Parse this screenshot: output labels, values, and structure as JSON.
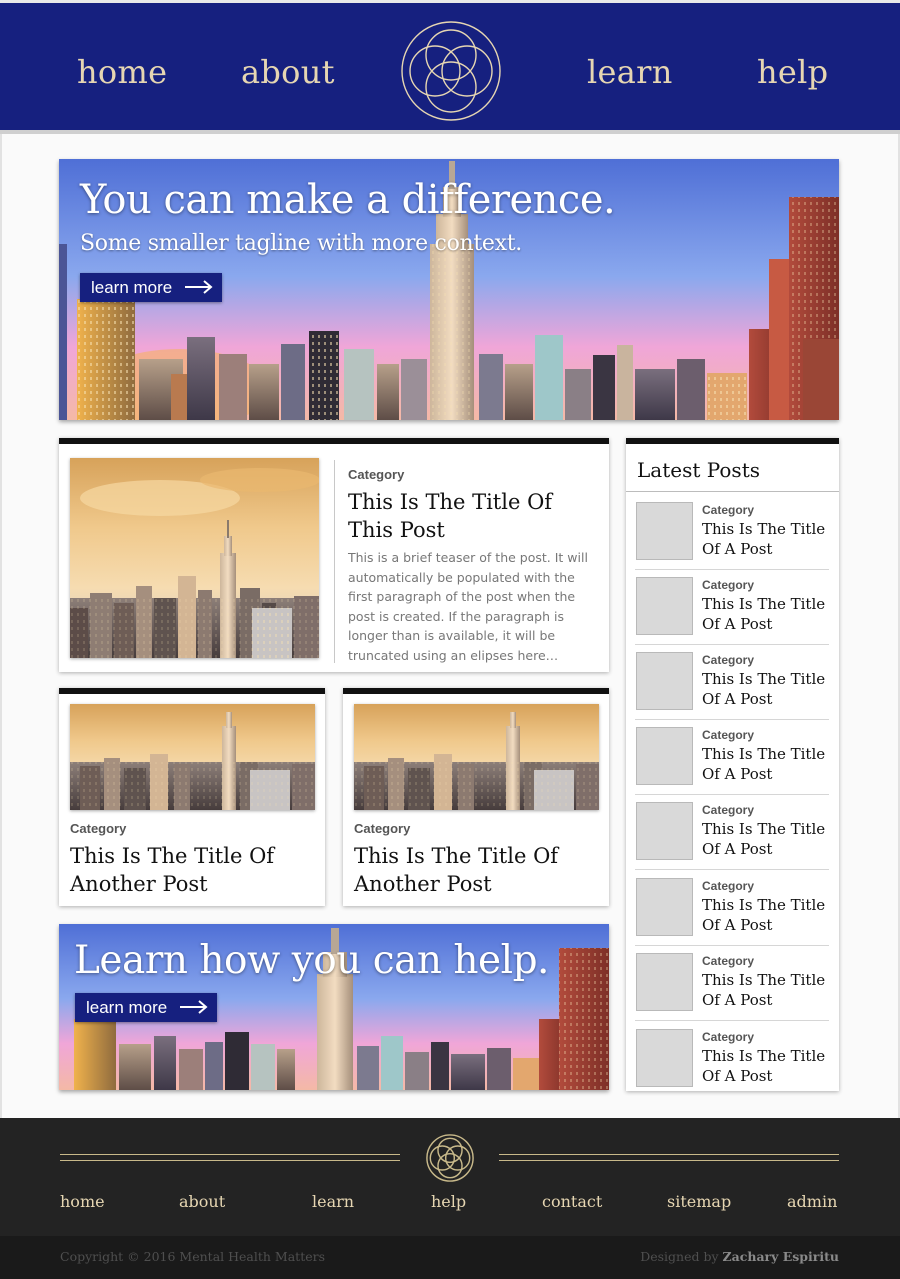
{
  "header": {
    "nav": [
      "home",
      "about",
      "learn",
      "help"
    ],
    "logo_icon": "interlocking-circles-logo"
  },
  "hero": {
    "title": "You can make a difference.",
    "tagline": "Some smaller tagline with more context.",
    "button_label": "learn more"
  },
  "featured_post": {
    "category": "Category",
    "title": "This Is The Title Of This Post",
    "teaser": "This is a brief teaser of the post. It will automatically be populated with the first paragraph of the post when the post is created. If the paragraph is longer than is available, it will be truncated using an elipses here…"
  },
  "small_posts": [
    {
      "category": "Category",
      "title": "This Is The Title Of Another Post"
    },
    {
      "category": "Category",
      "title": "This Is The Title Of Another Post"
    }
  ],
  "banner2": {
    "title": "Learn how you can help.",
    "button_label": "learn more"
  },
  "sidebar": {
    "heading": "Latest Posts",
    "items": [
      {
        "category": "Category",
        "title": "This Is The Title Of A Post"
      },
      {
        "category": "Category",
        "title": "This Is The Title Of A Post"
      },
      {
        "category": "Category",
        "title": "This Is The Title Of A Post"
      },
      {
        "category": "Category",
        "title": "This Is The Title Of A Post"
      },
      {
        "category": "Category",
        "title": "This Is The Title Of A Post"
      },
      {
        "category": "Category",
        "title": "This Is The Title Of A Post"
      },
      {
        "category": "Category",
        "title": "This Is The Title Of A Post"
      },
      {
        "category": "Category",
        "title": "This Is The Title Of A Post"
      }
    ]
  },
  "footer": {
    "nav": [
      "home",
      "about",
      "learn",
      "help",
      "contact",
      "sitemap",
      "admin"
    ],
    "copyright": "Copyright © 2016 Mental Health Matters",
    "credit_prefix": "Designed by",
    "credit_name": "Zachary Espiritu"
  },
  "colors": {
    "brand_navy": "#16207f",
    "accent_gold": "#e6d6b2",
    "footer_bg": "#232323"
  }
}
